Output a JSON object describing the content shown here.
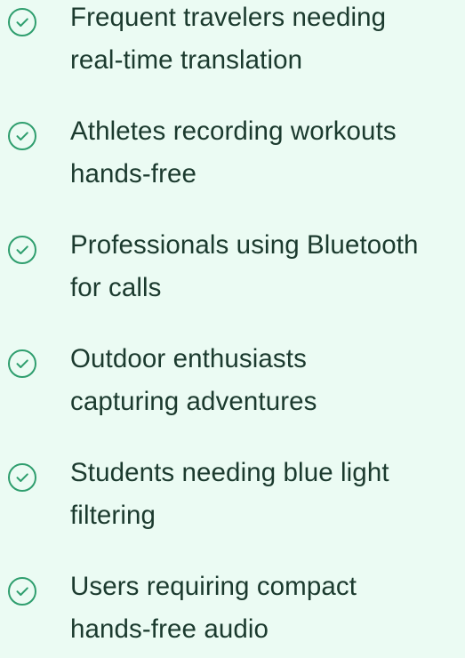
{
  "colors": {
    "background": "#ebfbf3",
    "text": "#1b3a2e",
    "accent": "#2f9e6e"
  },
  "icon": "check-circle-icon",
  "items": [
    {
      "lines": [
        "Frequent travelers needing",
        "real-time translation"
      ]
    },
    {
      "lines": [
        "Athletes recording workouts",
        "hands-free"
      ]
    },
    {
      "lines": [
        "Professionals using Bluetooth",
        "for calls"
      ]
    },
    {
      "lines": [
        "Outdoor enthusiasts",
        "capturing adventures"
      ]
    },
    {
      "lines": [
        "Students needing blue light",
        "filtering"
      ]
    },
    {
      "lines": [
        "Users requiring compact",
        "hands-free audio"
      ]
    }
  ]
}
